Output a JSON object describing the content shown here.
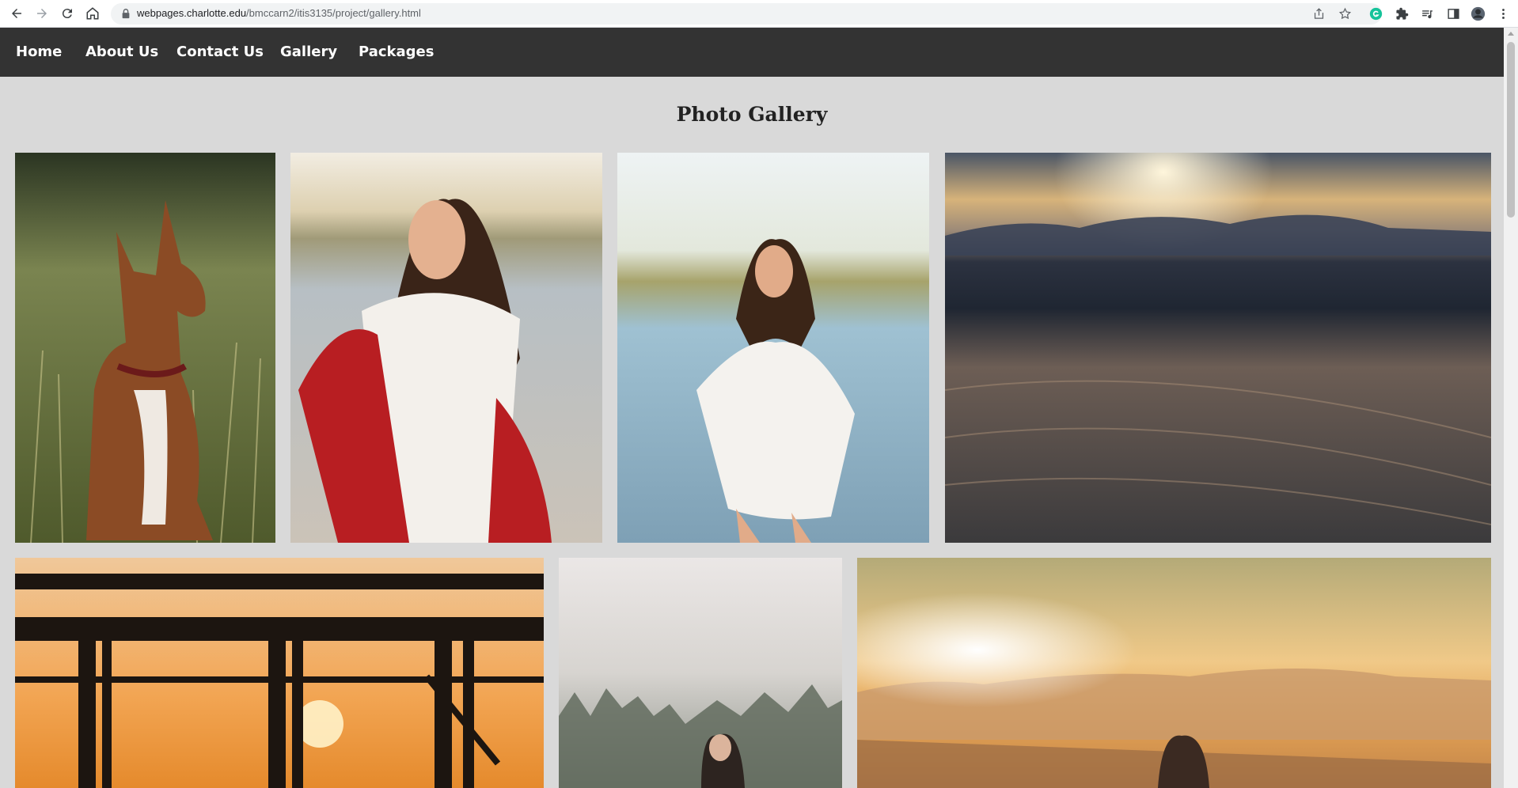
{
  "browser": {
    "url_host": "webpages.charlotte.edu",
    "url_path": "/bmccarn2/itis3135/project/gallery.html",
    "icons": [
      "back-icon",
      "forward-icon",
      "reload-icon",
      "home-icon",
      "lock-icon",
      "share-icon",
      "star-icon",
      "grammarly-icon",
      "extensions-icon",
      "media-icon",
      "sidepanel-icon",
      "profile-icon",
      "menu-icon"
    ]
  },
  "nav": {
    "links": [
      "Home",
      "About Us",
      "Contact Us",
      "Gallery",
      "Packages"
    ]
  },
  "page": {
    "title": "Photo Gallery"
  },
  "gallery": {
    "photos": [
      {
        "subject": "dog-in-grass"
      },
      {
        "subject": "woman-red-wrap-beach"
      },
      {
        "subject": "woman-white-dress-beach"
      },
      {
        "subject": "sand-dunes-sunset"
      },
      {
        "subject": "pier-sunset"
      },
      {
        "subject": "woman-foggy-forest"
      },
      {
        "subject": "woman-sunset-dunes"
      }
    ]
  },
  "colors": {
    "nav_bg": "#333333",
    "page_bg": "#d9d9d9",
    "nav_text": "#ffffff"
  }
}
